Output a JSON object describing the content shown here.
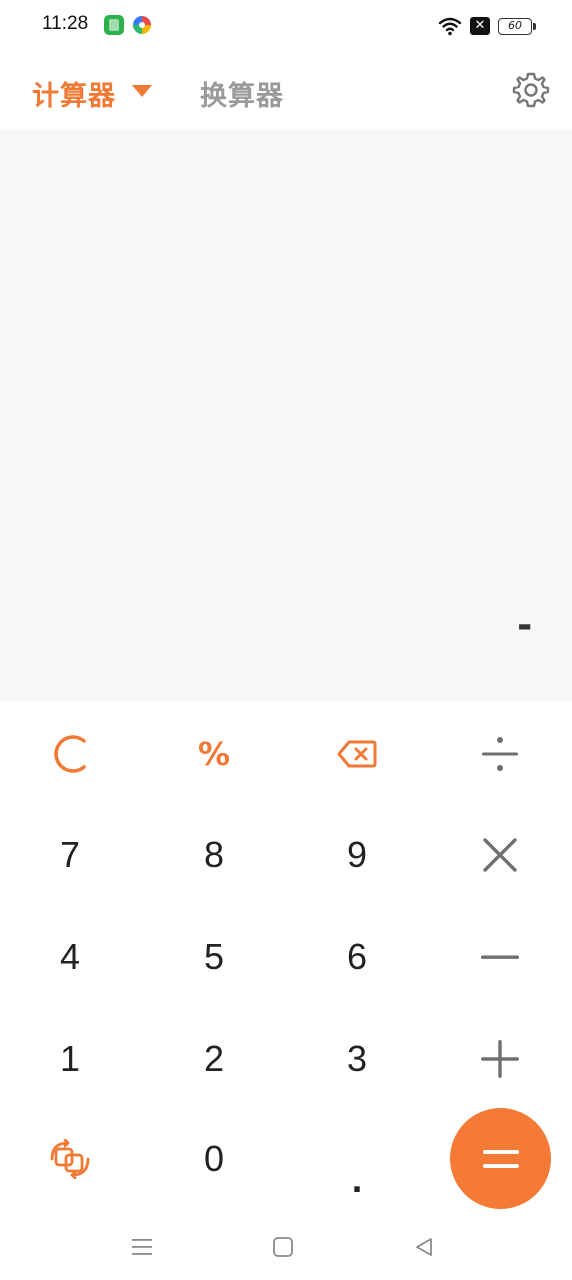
{
  "status_bar": {
    "time": "11:28",
    "battery": "60",
    "icons": [
      "app-icon",
      "pinwheel-icon",
      "wifi-icon",
      "close-box-icon",
      "battery-icon"
    ]
  },
  "header": {
    "tabs": [
      {
        "label": "计算器",
        "active": true
      },
      {
        "label": "换算器",
        "active": false
      }
    ],
    "settings_icon": "gear-icon"
  },
  "display": {
    "value": "-"
  },
  "keypad": {
    "rows": [
      [
        "C",
        "%",
        "backspace",
        "÷"
      ],
      [
        "7",
        "8",
        "9",
        "×"
      ],
      [
        "4",
        "5",
        "6",
        "−"
      ],
      [
        "1",
        "2",
        "3",
        "+"
      ],
      [
        "swap",
        "0",
        ".",
        "="
      ]
    ],
    "accent_color": "#f07a35"
  },
  "navbar": {
    "icons": [
      "menu-icon",
      "home-icon",
      "back-icon"
    ]
  }
}
